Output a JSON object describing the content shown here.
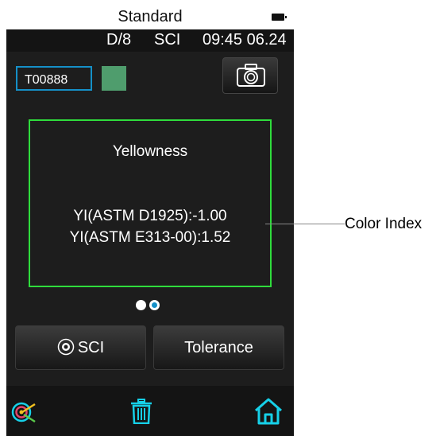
{
  "status": {
    "title": "Standard"
  },
  "info": {
    "geometry": "D/8",
    "mode": "SCI",
    "time": "09:45 06.24"
  },
  "sample": {
    "name": "T00888",
    "swatch_color": "#4f9d6d"
  },
  "panel": {
    "title": "Yellowness",
    "lines": [
      "YI(ASTM D1925):-1.00",
      "YI(ASTM E313-00):1.52"
    ]
  },
  "pager": {
    "pages": 2,
    "active": 2
  },
  "buttons": {
    "sci_label": "SCI",
    "tolerance_label": "Tolerance"
  },
  "toolbar": {
    "icons": [
      "target-icon",
      "trash-icon",
      "home-icon"
    ]
  },
  "annotation": {
    "label": "Color Index"
  },
  "colors": {
    "accent": "#14a4b8",
    "panel_border": "#2fdc3c",
    "icon": "#16d0e8"
  }
}
